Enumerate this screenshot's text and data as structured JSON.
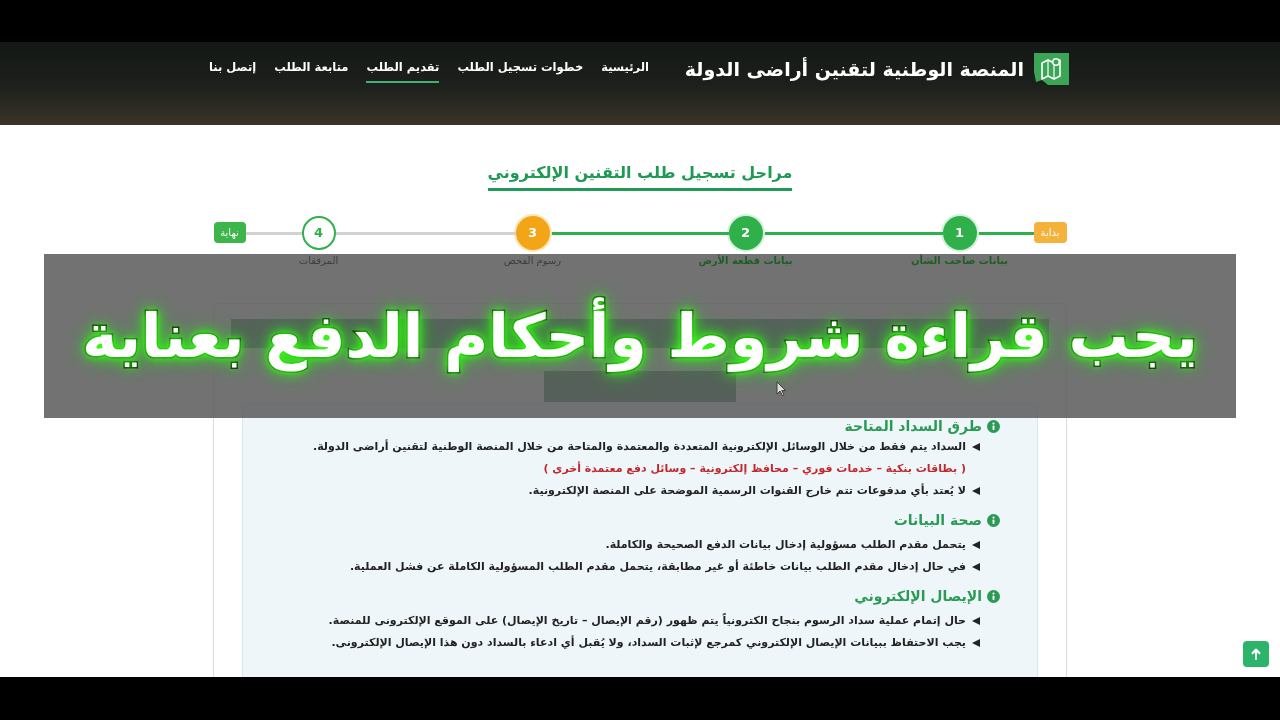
{
  "header": {
    "site_title": "المنصة الوطنية لتقنين أراضى الدولة",
    "nav": [
      {
        "label": "الرئيسية",
        "selected": false
      },
      {
        "label": "خطوات تسجيل الطلب",
        "selected": false
      },
      {
        "label": "تقديم الطلب",
        "selected": true
      },
      {
        "label": "متابعة الطلب",
        "selected": false
      },
      {
        "label": "إتصل بنا",
        "selected": false
      }
    ]
  },
  "page_title": "مراحل تسجيل طلب التقنين الإلكتروني",
  "stepper": {
    "start_label": "بداية",
    "end_label": "نهاية",
    "steps": [
      {
        "number": "1",
        "label": "بيانات صاحب الشأن",
        "completed": true,
        "selected": false
      },
      {
        "number": "2",
        "label": "بيانات قطعة الأرض",
        "completed": true,
        "selected": false
      },
      {
        "number": "3",
        "label": "رسوم الفحص",
        "completed": false,
        "selected": true
      },
      {
        "number": "4",
        "label": "المرفقات",
        "completed": false,
        "selected": false
      }
    ]
  },
  "caption": "يجب قراءة شروط وأحكام الدفع بعناية",
  "terms": {
    "sections": [
      {
        "heading": "طرق السداد المتاحة",
        "items": [
          {
            "kind": "bullet",
            "text": "السداد يتم فقط من خلال الوسائل الإلكترونية المتعددة والمعتمدة والمتاحة من خلال المنصة الوطنية لتقنين أراضى الدولة."
          },
          {
            "kind": "note",
            "text": "( بطاقات بنكية – خدمات فوري – محافظ إلكترونية – وسائل دفع معتمدة أخرى )"
          },
          {
            "kind": "bullet",
            "text": "لا يُعتد بأي مدفوعات تتم خارج القنوات الرسمية الموضحة على المنصة الإلكترونية."
          }
        ]
      },
      {
        "heading": "صحة البيانات",
        "items": [
          {
            "kind": "bullet",
            "text": "يتحمل مقدم الطلب مسؤولية إدخال بيانات الدفع الصحيحة والكاملة."
          },
          {
            "kind": "bullet",
            "text": "في حال إدخال مقدم الطلب بيانات خاطئة أو غير مطابقة، يتحمل مقدم الطلب المسؤولية الكاملة عن فشل العملية."
          }
        ]
      },
      {
        "heading": "الإيصال الإلكتروني",
        "items": [
          {
            "kind": "bullet",
            "text": "حال إتمام عملية سداد الرسوم بنجاح الكترونياً يتم ظهور (رقم الإيصال – تاريخ الإيصال) على الموقع الإلكترونى للمنصة."
          },
          {
            "kind": "bullet",
            "text": "يجب الاحتفاظ ببيانات الإيصال الإلكتروني كمرجع لإثبات السداد، ولا يُقبل أي ادعاء بالسداد دون هذا الإيصال الإلكترونى."
          }
        ]
      }
    ]
  }
}
